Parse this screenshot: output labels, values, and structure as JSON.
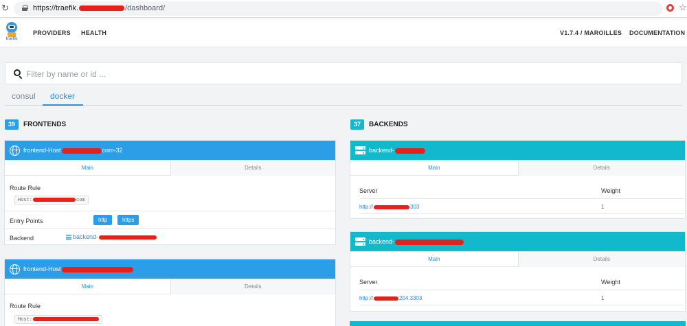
{
  "browser": {
    "url_host": "https://traefik.",
    "url_path": "/dashboard/"
  },
  "nav": {
    "logo_text": "træfik",
    "providers": "PROVIDERS",
    "health": "HEALTH",
    "version": "V1.7.4 / MAROILLES",
    "documentation": "DOCUMENTATION"
  },
  "filter": {
    "placeholder": "Filter by name or id ..."
  },
  "provider_tabs": [
    {
      "label": "consul",
      "active": false
    },
    {
      "label": "docker",
      "active": true
    }
  ],
  "frontends": {
    "count": "39",
    "title": "FRONTENDS",
    "items": [
      {
        "name_prefix": "frontend-Host",
        "name_suffix": "com-32",
        "tab_main": "Main",
        "tab_details": "Details",
        "route_rule_label": "Route Rule",
        "route_rule_prefix": "Host:",
        "route_rule_suffix": "com",
        "entry_points_label": "Entry Points",
        "entry_points": [
          "http",
          "https"
        ],
        "backend_label": "Backend",
        "backend_prefix": "backend-"
      },
      {
        "name_prefix": "frontend-Host",
        "tab_main": "Main",
        "tab_details": "Details",
        "route_rule_label": "Route Rule",
        "route_rule_prefix": "Host:"
      }
    ]
  },
  "backends": {
    "count": "37",
    "title": "BACKENDS",
    "items": [
      {
        "name_prefix": "backend-",
        "tab_main": "Main",
        "tab_details": "Details",
        "server_header": "Server",
        "weight_header": "Weight",
        "server_prefix": "http://",
        "server_suffix": "303",
        "weight": "1"
      },
      {
        "name_prefix": "backend-",
        "tab_main": "Main",
        "tab_details": "Details",
        "server_header": "Server",
        "weight_header": "Weight",
        "server_prefix": "http://",
        "server_suffix": "204.3303",
        "weight": "1"
      }
    ]
  },
  "colors": {
    "frontend_header": "#2c9ee8",
    "backend_header": "#12b8cc",
    "accent": "#2c8fd4",
    "redaction": "#e6211c"
  }
}
